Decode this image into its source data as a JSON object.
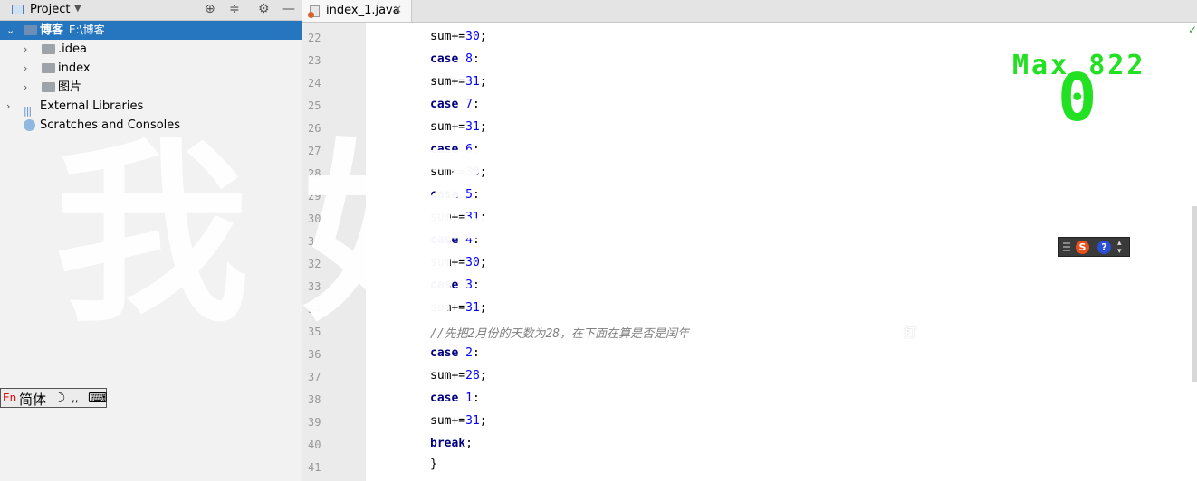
{
  "project_panel": {
    "title": "Project",
    "tree": [
      {
        "label": "博客",
        "sub": "E:\\博客",
        "selected": true,
        "expanded": true
      },
      {
        "label": ".idea"
      },
      {
        "label": "index"
      },
      {
        "label": "图片"
      },
      {
        "label": "External Libraries"
      },
      {
        "label": "Scratches and Consoles"
      }
    ]
  },
  "editor": {
    "tab_label": "index_1.java",
    "tab_close": "×",
    "line_numbers": [
      "22",
      "23",
      "24",
      "25",
      "26",
      "27",
      "28",
      "29",
      "30",
      "31",
      "32",
      "33",
      "34",
      "35",
      "36",
      "37",
      "38",
      "39",
      "40",
      "41"
    ],
    "comment": "//先把2月份的天数为28，在下面在算是否是闰年",
    "break_kw": "break",
    "close_brace": "}"
  },
  "overlay": {
    "watermark": "我好想你",
    "small_char": "打",
    "max_label": "Max 822",
    "score": "0"
  },
  "ime": {
    "lang_en": "En",
    "lang_mode": "简体",
    "moon": "☽",
    "punct": "‚,",
    "keyboard": "⌨",
    "sogou": "S",
    "help": "?"
  },
  "colors": {
    "accent": "#2675bf",
    "keyword": "#000080",
    "number": "#0000ff",
    "game_green": "#22e022"
  }
}
